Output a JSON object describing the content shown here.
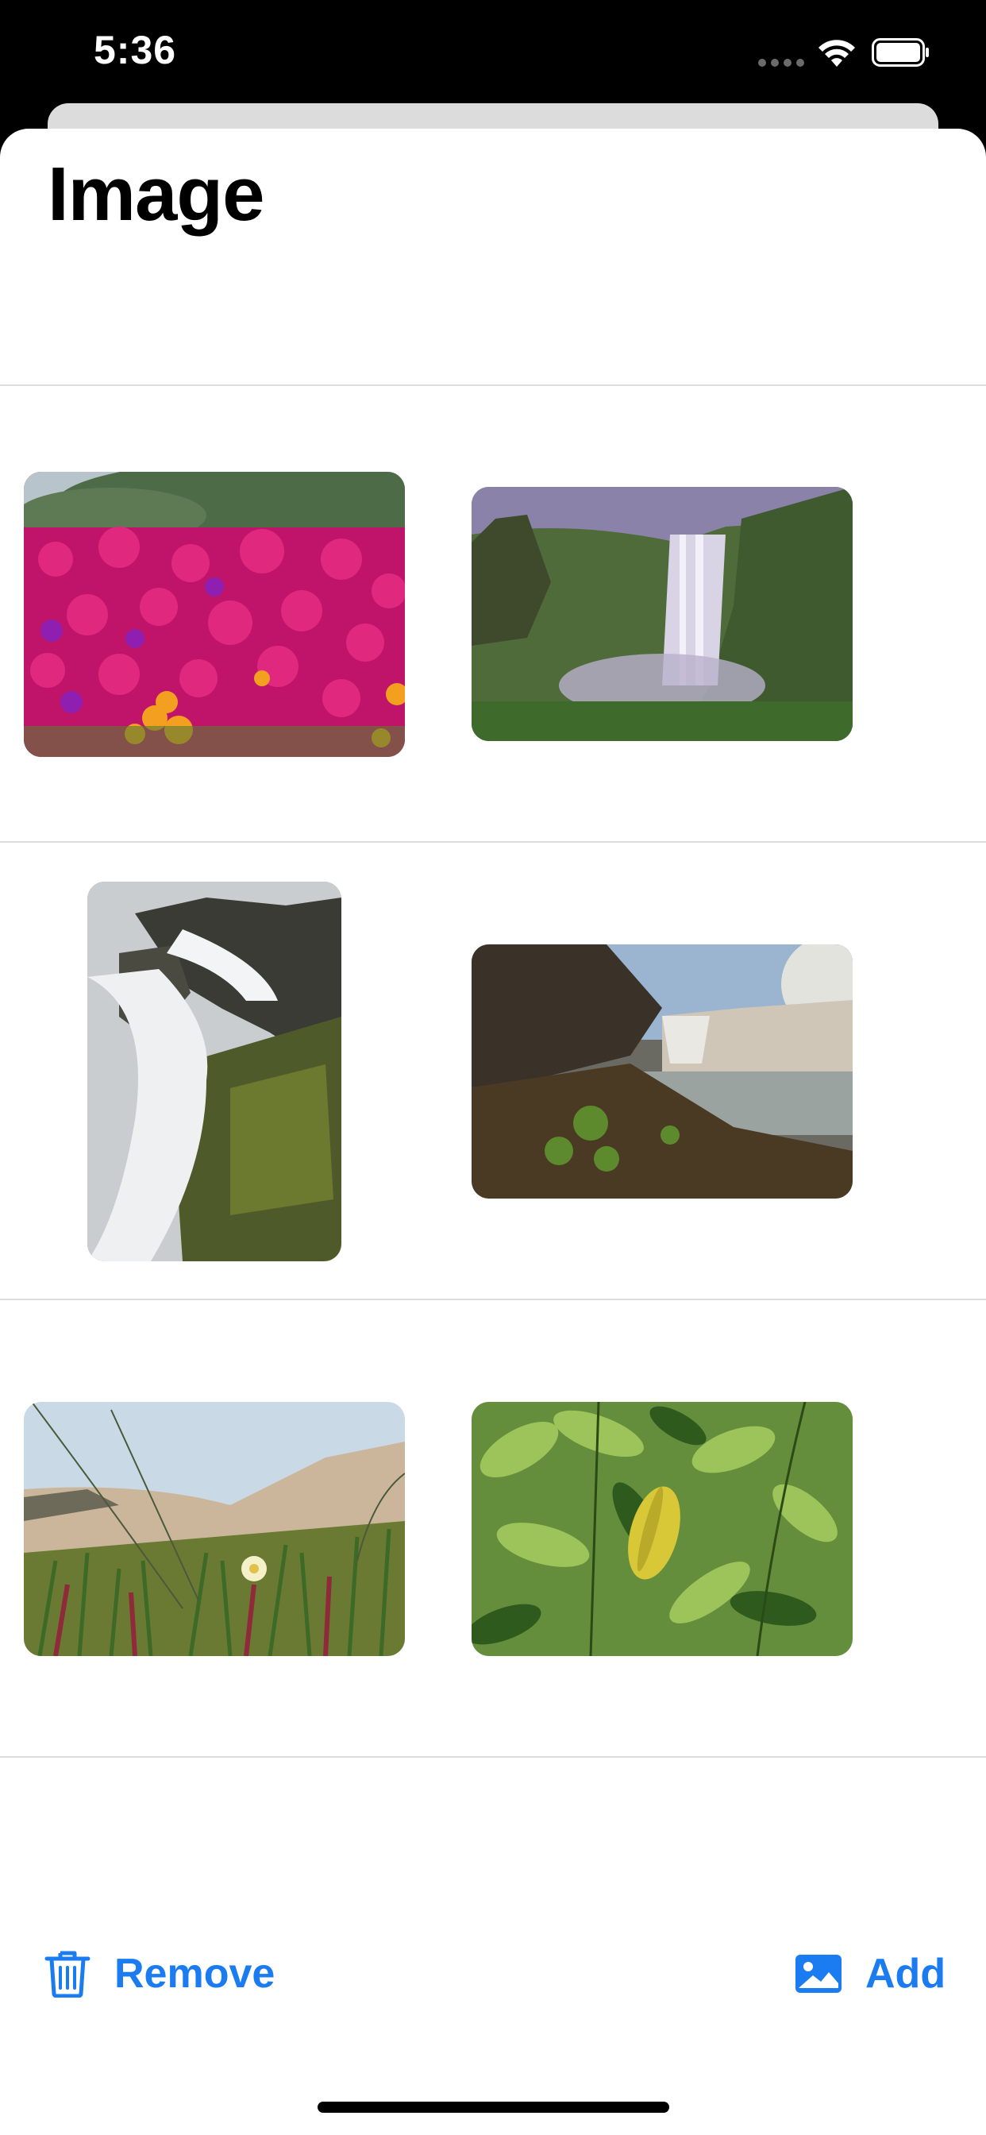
{
  "status_bar": {
    "time": "5:36",
    "icons": [
      "cellular-signal-icon",
      "wifi-icon",
      "battery-icon"
    ]
  },
  "header": {
    "title": "Image"
  },
  "gallery": {
    "rows": [
      {
        "items": [
          "flowers-photo",
          "waterfall-cliff-photo"
        ]
      },
      {
        "items": [
          "cascade-rocks-photo",
          "waterfall-shore-photo"
        ]
      },
      {
        "items": [
          "dune-grass-photo",
          "green-leaves-photo"
        ]
      }
    ]
  },
  "toolbar": {
    "remove_label": "Remove",
    "add_label": "Add"
  },
  "colors": {
    "accent": "#1a7cf0",
    "divider": "#dcdcdc",
    "background": "#ffffff"
  }
}
